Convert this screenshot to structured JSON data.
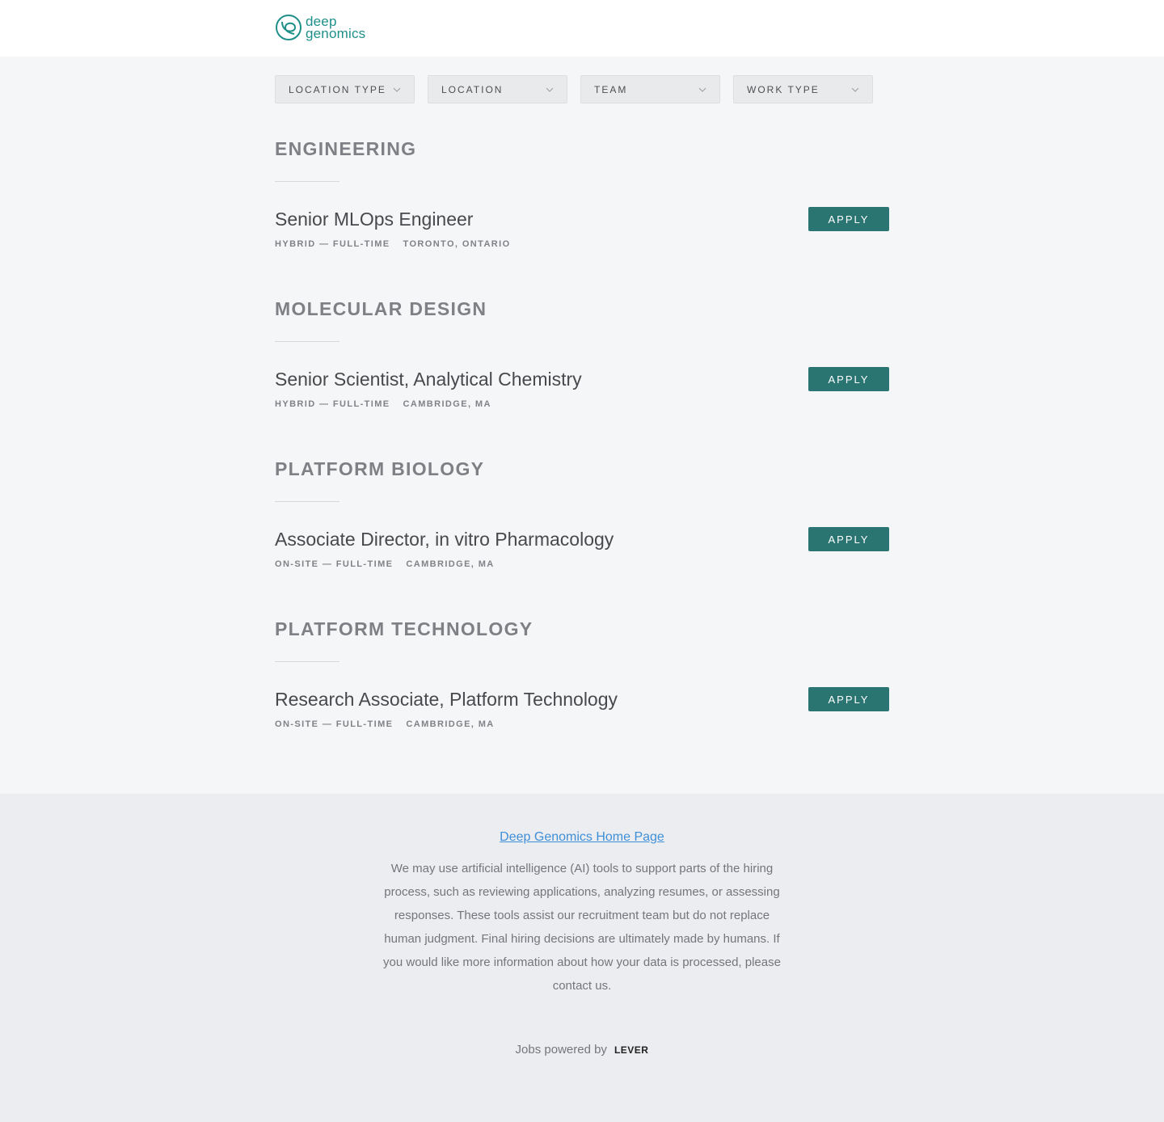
{
  "header": {
    "logo_line1": "deep",
    "logo_line2": "genomics"
  },
  "filters": [
    {
      "label": "LOCATION TYPE"
    },
    {
      "label": "LOCATION"
    },
    {
      "label": "TEAM"
    },
    {
      "label": "WORK TYPE"
    }
  ],
  "sections": [
    {
      "title": "ENGINEERING",
      "posting": {
        "title": "Senior MLOps Engineer",
        "commitment": "HYBRID — FULL-TIME",
        "location": "TORONTO, ONTARIO",
        "apply_label": "APPLY"
      }
    },
    {
      "title": "MOLECULAR DESIGN",
      "posting": {
        "title": "Senior Scientist, Analytical Chemistry",
        "commitment": "HYBRID — FULL-TIME",
        "location": "CAMBRIDGE, MA",
        "apply_label": "APPLY"
      }
    },
    {
      "title": "PLATFORM BIOLOGY",
      "posting": {
        "title": "Associate Director, in vitro Pharmacology",
        "commitment": "ON-SITE — FULL-TIME",
        "location": "CAMBRIDGE, MA",
        "apply_label": "APPLY"
      }
    },
    {
      "title": "PLATFORM TECHNOLOGY",
      "posting": {
        "title": "Research Associate, Platform Technology",
        "commitment": "ON-SITE — FULL-TIME",
        "location": "CAMBRIDGE, MA",
        "apply_label": "APPLY"
      }
    }
  ],
  "footer": {
    "home_link": "Deep Genomics Home Page",
    "disclaimer": "We may use artificial intelligence (AI) tools to support parts of the hiring process, such as reviewing applications, analyzing resumes, or assessing responses. These tools assist our recruitment team but do not replace human judgment. Final hiring decisions are ultimately made by humans. If you would like more information about how your data is processed, please contact us.",
    "powered_by": "Jobs powered by",
    "lever": "LEVER"
  },
  "colors": {
    "accent": "#2a7472",
    "logo": "#1f8f89",
    "link": "#3f8fd8"
  }
}
